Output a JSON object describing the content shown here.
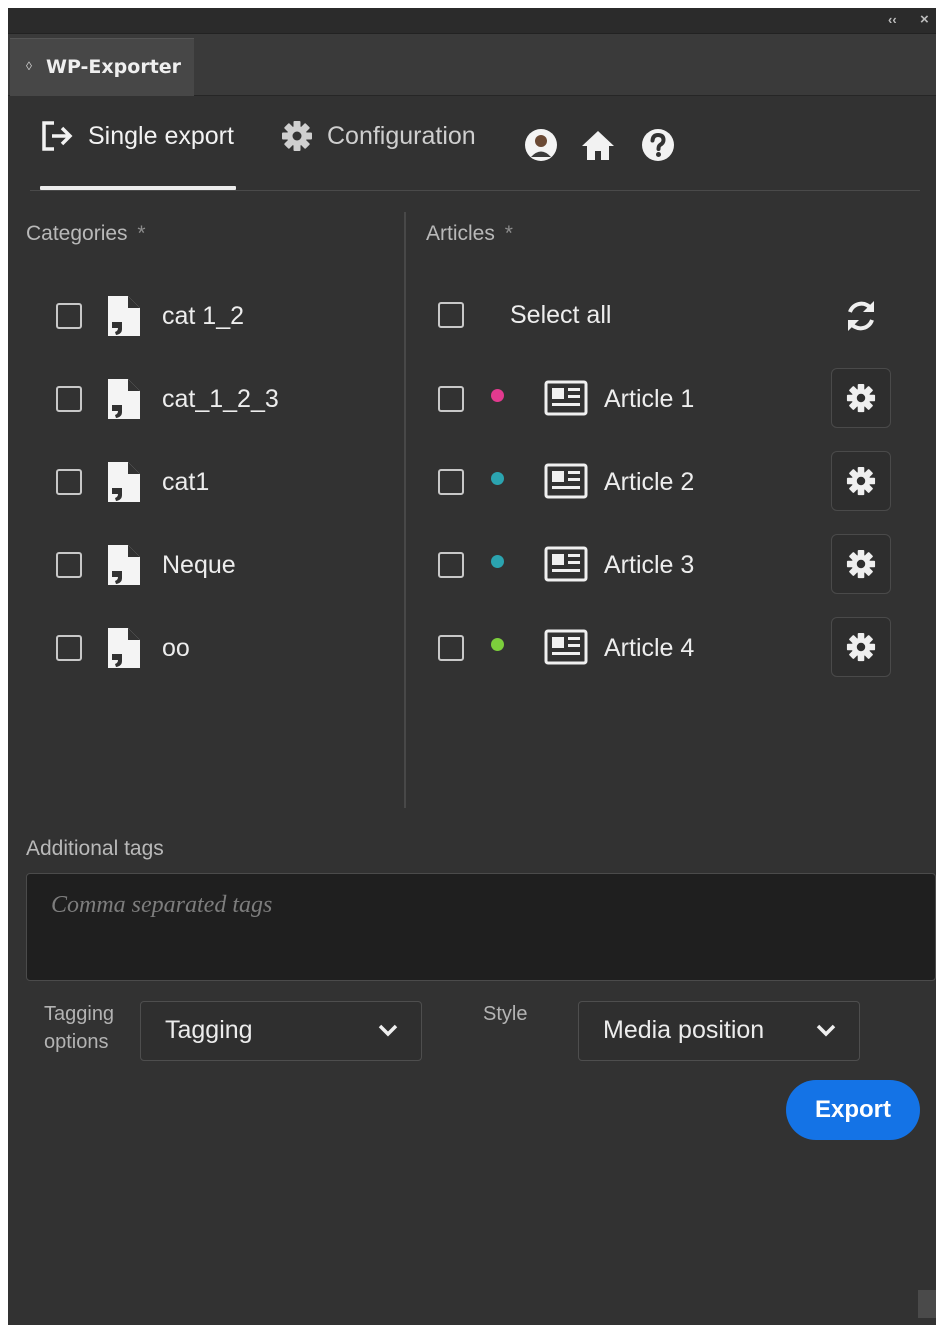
{
  "panel": {
    "title": "WP-Exporter",
    "grip_glyph": "◊",
    "collapse_glyph": "‹‹",
    "close_glyph": "×"
  },
  "nav": {
    "tabs": [
      {
        "label": "Single export",
        "icon": "export-icon",
        "active": true
      },
      {
        "label": "Configuration",
        "icon": "gear-icon",
        "active": false
      }
    ],
    "icons": [
      "user-avatar-icon",
      "home-icon",
      "help-icon"
    ]
  },
  "categories": {
    "label": "Categories",
    "required_mark": "*",
    "items": [
      {
        "label": "cat 1_2"
      },
      {
        "label": "cat_1_2_3"
      },
      {
        "label": "cat1"
      },
      {
        "label": "Neque"
      },
      {
        "label": "oo"
      }
    ]
  },
  "articles": {
    "label": "Articles",
    "required_mark": "*",
    "select_all_label": "Select all",
    "items": [
      {
        "label": "Article 1",
        "status_color": "#e23a8f"
      },
      {
        "label": "Article 2",
        "status_color": "#2ba4b0"
      },
      {
        "label": "Article 3",
        "status_color": "#2ba4b0"
      },
      {
        "label": "Article 4",
        "status_color": "#7cce3c"
      }
    ]
  },
  "tags": {
    "label": "Additional tags",
    "placeholder": "Comma separated tags"
  },
  "tagging": {
    "label_line1": "Tagging",
    "label_line2": "options",
    "value": "Tagging"
  },
  "style": {
    "label": "Style",
    "value": "Media position"
  },
  "actions": {
    "export_label": "Export",
    "accent_color": "#1473e6"
  }
}
